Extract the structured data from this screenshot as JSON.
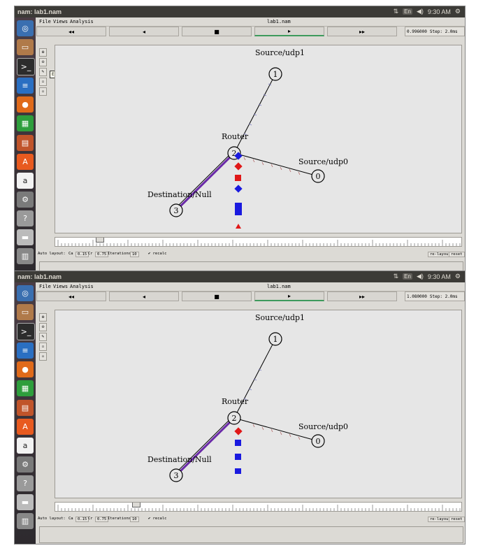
{
  "shots": [
    {
      "panel": {
        "title": "nam: lab1.nam",
        "keyboard": "En",
        "clock": "9:30 AM"
      },
      "menus": [
        "File",
        "Views",
        "Analysis"
      ],
      "file_name": "lab1.nam",
      "controls": {
        "rewind": "◂◂",
        "back": "◂",
        "stop": "■",
        "play": "▸",
        "fastforward": "▸▸"
      },
      "time": "0.996000",
      "step": "Step: 2.0ms",
      "tooltip": "Edit/View",
      "nodes": {
        "n1": "1",
        "n2": "2",
        "n0": "0",
        "n3": "3"
      },
      "labels": {
        "source1": "Source/udp1",
        "router": "Router",
        "source0": "Source/udp0",
        "dest": "Destination/Null"
      },
      "layout": {
        "auto": "Auto layout:",
        "ca_label": "Ca",
        "ca": "0.15",
        "cr_label": "Cr",
        "cr": "0.75",
        "iter_label": "Iterations",
        "iter": "10",
        "recalc": "✔ recalc",
        "relayout": "re-layout",
        "reset": "reset"
      }
    },
    {
      "panel": {
        "title": "nam: lab1.nam",
        "keyboard": "En",
        "clock": "9:30 AM"
      },
      "menus": [
        "File",
        "Views",
        "Analysis"
      ],
      "file_name": "lab1.nam",
      "controls": {
        "rewind": "◂◂",
        "back": "◂",
        "stop": "■",
        "play": "▸",
        "fastforward": "▸▸"
      },
      "time": "1.080000",
      "step": "Step: 2.0ms",
      "nodes": {
        "n1": "1",
        "n2": "2",
        "n0": "0",
        "n3": "3"
      },
      "labels": {
        "source1": "Source/udp1",
        "router": "Router",
        "source0": "Source/udp0",
        "dest": "Destination/Null"
      },
      "layout": {
        "auto": "Auto layout:",
        "ca_label": "Ca",
        "ca": "0.15",
        "cr_label": "Cr",
        "cr": "0.75",
        "iter_label": "Iterations",
        "iter": "10",
        "recalc": "✔ recalc",
        "relayout": "re-layout",
        "reset": "reset"
      }
    }
  ],
  "colors": {
    "packet_blue": "#1a1adf",
    "packet_red": "#e01818",
    "link_purple": "#6a2aa8",
    "panel_bg": "#3c3b37",
    "play_active": "#3d9a5c"
  }
}
